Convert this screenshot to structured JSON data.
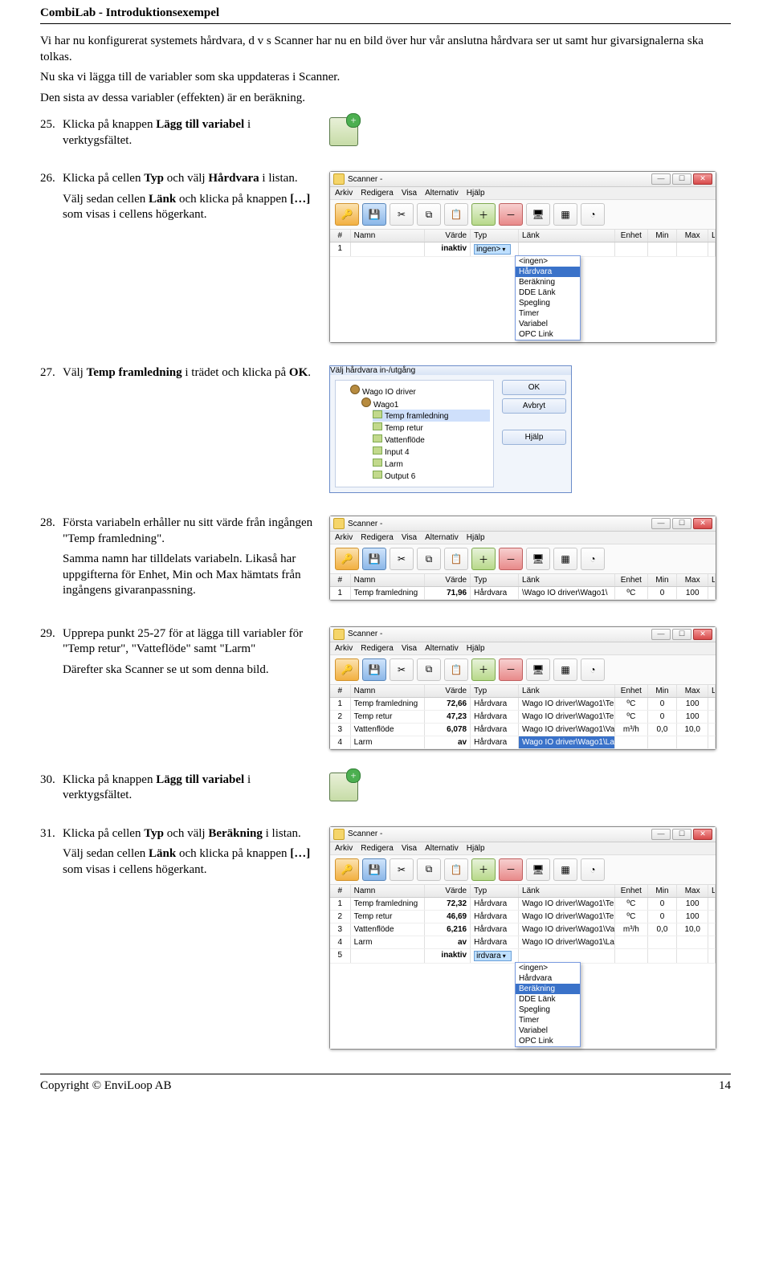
{
  "header": {
    "title": "CombiLab - Introduktionsexempel"
  },
  "intro": {
    "p1": "Vi har nu konfigurerat systemets hårdvara, d v s Scanner har nu en bild över hur vår anslutna hårdvara ser ut samt hur givarsignalerna ska tolkas.",
    "p2": "Nu ska vi lägga till de variabler som ska uppdateras i Scanner.",
    "p3": "Den sista av dessa variabler (effekten) är en beräkning."
  },
  "steps": {
    "s25": {
      "num": "25.",
      "a": "Klicka på knappen ",
      "b": "Lägg till variabel",
      "c": " i verktygsfältet."
    },
    "s26": {
      "num": "26.",
      "a": "Klicka på cellen ",
      "b": "Typ",
      "c": " och välj ",
      "d": "Hårdvara",
      "e": " i listan.",
      "p2a": "Välj sedan cellen ",
      "p2b": "Länk",
      "p2c": " och klicka på knappen ",
      "p2d": "[…]",
      "p2e": " som visas i cellens högerkant."
    },
    "s27": {
      "num": "27.",
      "a": "Välj ",
      "b": "Temp framledning",
      "c": " i trädet och klicka på ",
      "d": "OK",
      "e": "."
    },
    "s28": {
      "num": "28.",
      "a": "Första variabeln erhåller nu sitt värde från ingången \"Temp framledning\".",
      "b": "Samma namn har tilldelats variabeln. Likaså har uppgifterna för Enhet, Min och Max hämtats från ingångens givaranpassning."
    },
    "s29": {
      "num": "29.",
      "a": "Upprepa punkt 25-27 för at lägga till variabler för \"Temp retur\", \"Vatteflöde\" samt \"Larm\"",
      "b": "Därefter ska Scanner se ut som denna bild."
    },
    "s30": {
      "num": "30.",
      "a": "Klicka på knappen ",
      "b": "Lägg till variabel",
      "c": " i verktygsfältet."
    },
    "s31": {
      "num": "31.",
      "a": "Klicka på cellen ",
      "b": "Typ",
      "c": " och välj ",
      "d": "Beräkning",
      "e": " i listan.",
      "p2a": "Välj sedan cellen ",
      "p2b": "Länk",
      "p2c": " och klicka på knappen ",
      "p2d": "[…]",
      "p2e": " som visas i cellens högerkant."
    }
  },
  "common": {
    "scannerTitle": "Scanner -",
    "menus": [
      "Arkiv",
      "Redigera",
      "Visa",
      "Alternativ",
      "Hjälp"
    ],
    "columns": {
      "idx": "#",
      "name": "Namn",
      "val": "Värde",
      "typ": "Typ",
      "link": "Länk",
      "en": "Enhet",
      "min": "Min",
      "max": "Max",
      "lock": "Lås värde"
    },
    "typeOptions": [
      "<ingen>",
      "Hårdvara",
      "Beräkning",
      "DDE Länk",
      "Spegling",
      "Timer",
      "Variabel",
      "OPC Link"
    ]
  },
  "win26": {
    "row": {
      "idx": "1",
      "name": "",
      "val": "inaktiv",
      "typ_dd": "ingen>",
      "link": "",
      "en": "",
      "min": "",
      "max": "",
      "lock": ""
    },
    "selectedOption": "Hårdvara"
  },
  "dlg27": {
    "title": "Välj hårdvara in-/utgång",
    "btnOk": "OK",
    "btnCancel": "Avbryt",
    "btnHelp": "Hjälp",
    "root": "Wago IO driver",
    "node": "Wago1",
    "items": [
      "Temp framledning",
      "Temp retur",
      "Vattenflöde",
      "Input 4",
      "Larm",
      "Output 6"
    ],
    "selected": "Temp framledning"
  },
  "win28": {
    "row": {
      "idx": "1",
      "name": "Temp framledning",
      "val": "71,96",
      "typ": "Hårdvara",
      "link": "\\Wago IO driver\\Wago1\\",
      "en": "ºC",
      "min": "0",
      "max": "100",
      "lock": ""
    }
  },
  "win29": {
    "rows": [
      {
        "idx": "1",
        "name": "Temp framledning",
        "val": "72,66",
        "typ": "Hårdvara",
        "link": "Wago IO driver\\Wago1\\Te",
        "en": "ºC",
        "min": "0",
        "max": "100",
        "lock": ""
      },
      {
        "idx": "2",
        "name": "Temp retur",
        "val": "47,23",
        "typ": "Hårdvara",
        "link": "Wago IO driver\\Wago1\\Te",
        "en": "ºC",
        "min": "0",
        "max": "100",
        "lock": ""
      },
      {
        "idx": "3",
        "name": "Vattenflöde",
        "val": "6,078",
        "typ": "Hårdvara",
        "link": "Wago IO driver\\Wago1\\Va",
        "en": "m³/h",
        "min": "0,0",
        "max": "10,0",
        "lock": ""
      },
      {
        "idx": "4",
        "name": "Larm",
        "val": "av",
        "typ": "Hårdvara",
        "link": "Wago IO driver\\Wago1\\La",
        "en": "",
        "min": "",
        "max": "",
        "lock": ""
      }
    ]
  },
  "win31": {
    "rows": [
      {
        "idx": "1",
        "name": "Temp framledning",
        "val": "72,32",
        "typ": "Hårdvara",
        "link": "Wago IO driver\\Wago1\\Te",
        "en": "ºC",
        "min": "0",
        "max": "100",
        "lock": ""
      },
      {
        "idx": "2",
        "name": "Temp retur",
        "val": "46,69",
        "typ": "Hårdvara",
        "link": "Wago IO driver\\Wago1\\Te",
        "en": "ºC",
        "min": "0",
        "max": "100",
        "lock": ""
      },
      {
        "idx": "3",
        "name": "Vattenflöde",
        "val": "6,216",
        "typ": "Hårdvara",
        "link": "Wago IO driver\\Wago1\\Va",
        "en": "m³/h",
        "min": "0,0",
        "max": "10,0",
        "lock": ""
      },
      {
        "idx": "4",
        "name": "Larm",
        "val": "av",
        "typ": "Hårdvara",
        "link": "Wago IO driver\\Wago1\\La",
        "en": "",
        "min": "",
        "max": "",
        "lock": ""
      }
    ],
    "newRow": {
      "idx": "5",
      "name": "",
      "val": "inaktiv",
      "typ_dd": "irdvara",
      "link": "",
      "en": "",
      "min": "",
      "max": "",
      "lock": ""
    },
    "selectedOption": "Beräkning"
  },
  "footer": {
    "left": "Copyright © EnviLoop AB",
    "right": "14"
  }
}
